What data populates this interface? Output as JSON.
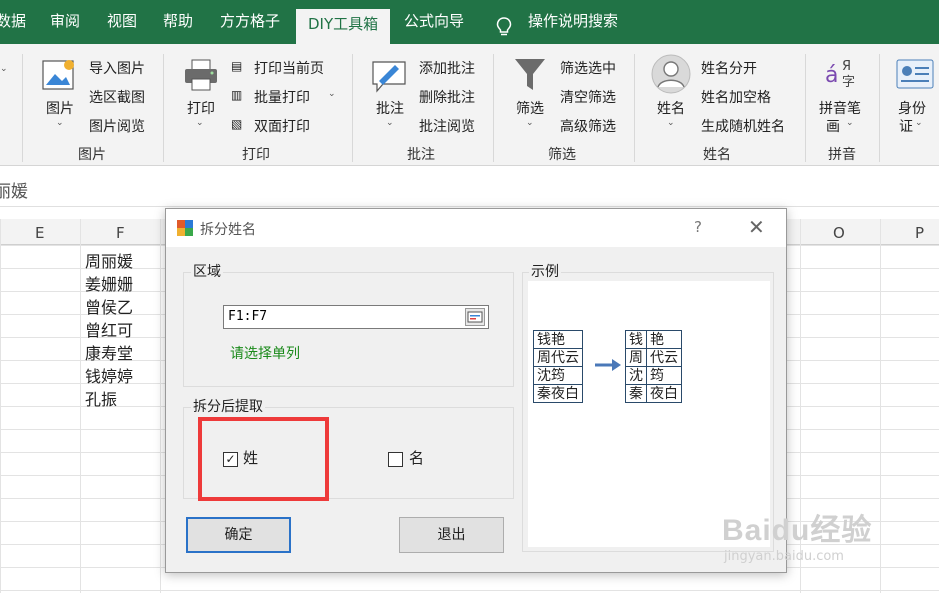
{
  "tabs": [
    {
      "label": "数据",
      "active": false
    },
    {
      "label": "审阅",
      "active": false
    },
    {
      "label": "视图",
      "active": false
    },
    {
      "label": "帮助",
      "active": false
    },
    {
      "label": "方方格子",
      "active": false
    },
    {
      "label": "DIY工具箱",
      "active": true
    },
    {
      "label": "公式向导",
      "active": false
    },
    {
      "label": "操作说明搜索",
      "active": false
    }
  ],
  "ribbon": {
    "picture": {
      "big": "图片",
      "items": [
        "导入图片",
        "选区截图",
        "图片阅览"
      ],
      "group": "图片"
    },
    "print": {
      "big": "打印",
      "items": [
        "打印当前页",
        "批量打印",
        "双面打印"
      ],
      "group": "打印"
    },
    "comment": {
      "big": "批注",
      "items": [
        "添加批注",
        "删除批注",
        "批注阅览"
      ],
      "group": "批注"
    },
    "filter": {
      "big": "筛选",
      "items": [
        "筛选选中",
        "清空筛选",
        "高级筛选"
      ],
      "group": "筛选"
    },
    "name": {
      "big": "姓名",
      "items": [
        "姓名分开",
        "姓名加空格",
        "生成随机姓名"
      ],
      "group": "姓名"
    },
    "pinyin": {
      "big1": "拼音笔",
      "big2": "画",
      "group": "拼音"
    },
    "id": {
      "big1": "身份",
      "big2": "证"
    }
  },
  "formula_value": "丽媛",
  "columns": [
    "E",
    "F",
    "O",
    "P"
  ],
  "cells_F": [
    "周丽媛",
    "姜姗姗",
    "曾侯乙",
    "曾红可",
    "康寿堂",
    "钱婷婷",
    "孔振"
  ],
  "dialog": {
    "title": "拆分姓名",
    "help": "?",
    "close": "✕",
    "region_label": "区域",
    "range_value": "F1:F7",
    "hint": "请选择单列",
    "extract_label": "拆分后提取",
    "surname_label": "姓",
    "surname_checked": true,
    "given_label": "名",
    "given_checked": false,
    "ok_label": "确定",
    "exit_label": "退出",
    "example_label": "示例",
    "example_left": [
      "钱艳",
      "周代云",
      "沈筠",
      "秦夜白"
    ],
    "example_right": [
      [
        "钱",
        "艳"
      ],
      [
        "周",
        "代云"
      ],
      [
        "沈",
        "筠"
      ],
      [
        "秦",
        "夜白"
      ]
    ]
  },
  "watermark": {
    "brand": "Baidu经验",
    "url": "jingyan.baidu.com"
  },
  "colors": {
    "excel_green": "#217346",
    "highlight_red": "#ee3a3a",
    "hint_green": "#1a8a1a"
  }
}
